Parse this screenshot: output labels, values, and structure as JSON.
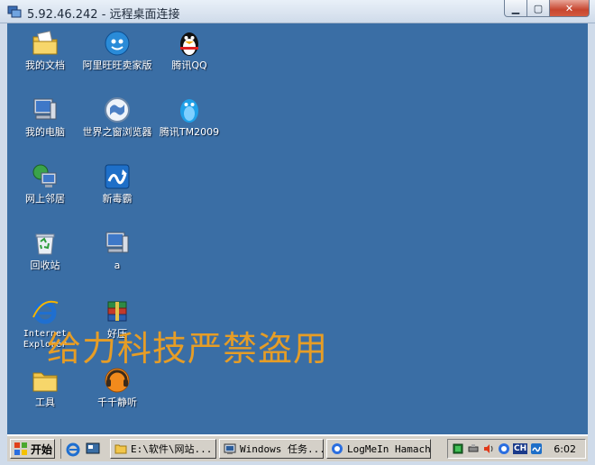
{
  "window": {
    "title": "5.92.46.242 - 远程桌面连接",
    "min_label": "▁",
    "max_label": "▢",
    "close_label": "✕"
  },
  "desktop": {
    "background_color": "#3a6ea5",
    "icons": [
      {
        "label": "我的文档",
        "icon": "folder-documents-icon"
      },
      {
        "label": "阿里旺旺卖家版",
        "icon": "aliwangwang-icon"
      },
      {
        "label": "腾讯QQ",
        "icon": "qq-penguin-icon"
      },
      {
        "label": "我的电脑",
        "icon": "my-computer-icon"
      },
      {
        "label": "世界之窗浏览器",
        "icon": "theworld-browser-icon"
      },
      {
        "label": "腾讯TM2009",
        "icon": "tencent-tm-icon"
      },
      {
        "label": "网上邻居",
        "icon": "network-places-icon"
      },
      {
        "label": "新毒霸",
        "icon": "duba-antivirus-icon"
      },
      {
        "label": "回收站",
        "icon": "recycle-bin-icon"
      },
      {
        "label": "a",
        "icon": "computer-shortcut-icon"
      },
      {
        "label": "Internet Explorer",
        "icon": "internet-explorer-icon"
      },
      {
        "label": "好压",
        "icon": "haozip-icon"
      },
      {
        "label": "工具",
        "icon": "folder-tools-icon"
      },
      {
        "label": "千千静听",
        "icon": "ttplayer-icon"
      }
    ],
    "watermark": "给力科技严禁盗用"
  },
  "taskbar": {
    "start_label": "开始",
    "tasks": [
      {
        "label": "E:\\软件\\网站...",
        "icon": "folder-icon"
      },
      {
        "label": "Windows 任务...",
        "icon": "task-manager-icon"
      },
      {
        "label": "LogMeIn Hamachi",
        "icon": "hamachi-icon"
      }
    ],
    "tray": {
      "lang": "CH",
      "clock": "6:02"
    }
  }
}
